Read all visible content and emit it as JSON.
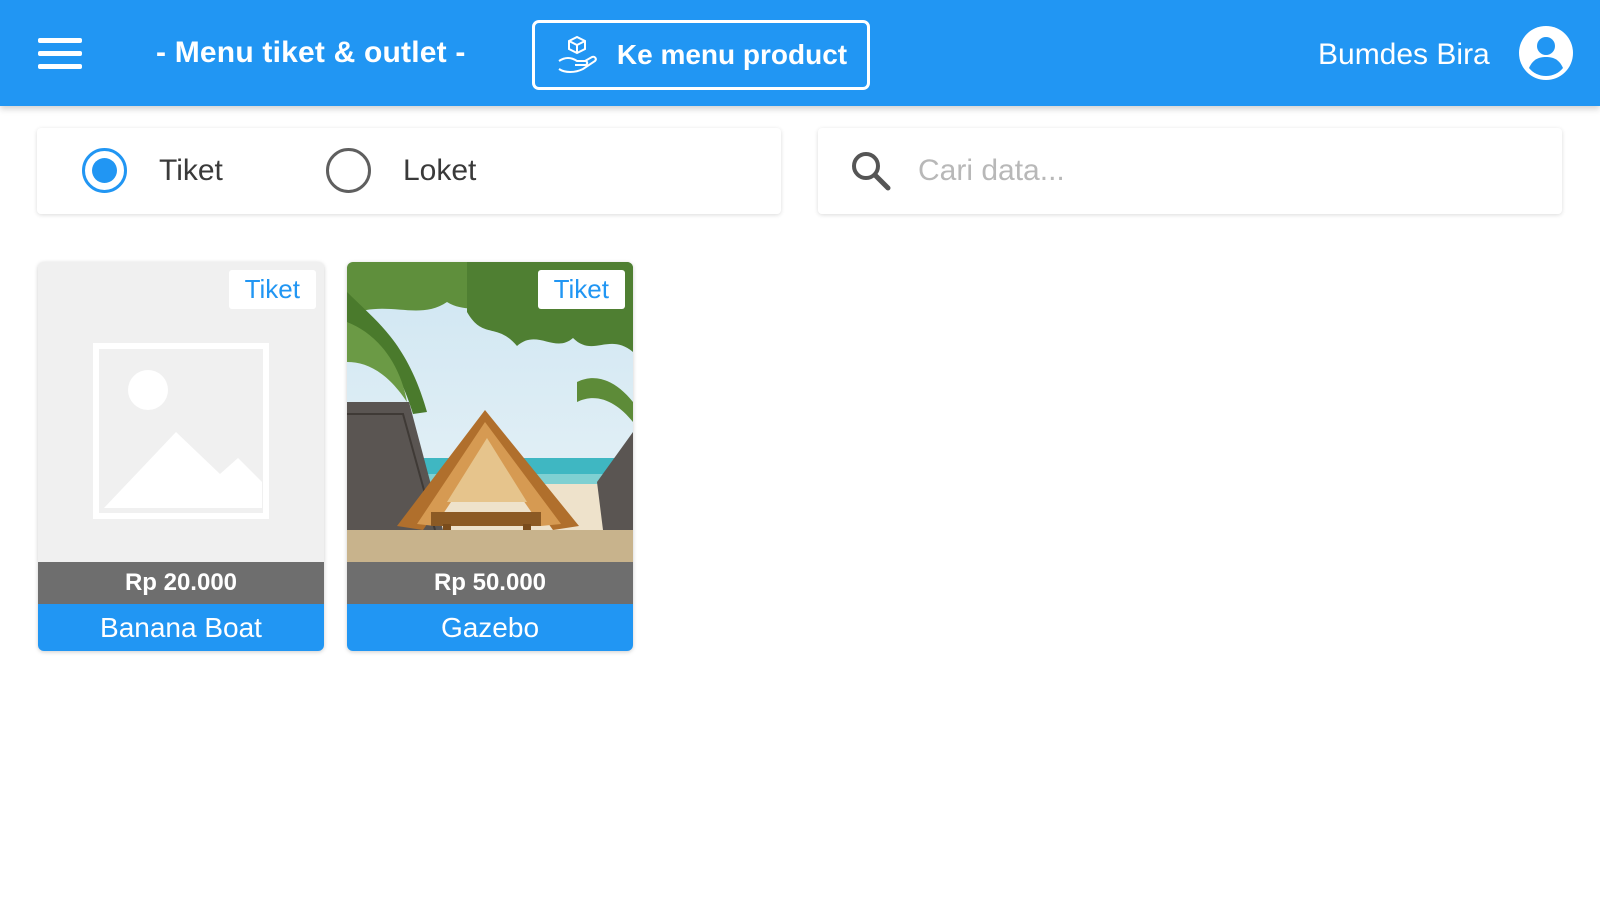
{
  "header": {
    "title": "- Menu tiket & outlet -",
    "product_button_label": "Ke menu product",
    "product_button_icon": "box-hand-icon",
    "user_name": "Bumdes Bira",
    "menu_icon": "hamburger-menu-icon",
    "avatar_icon": "account-circle-icon",
    "accent_color": "#2196f3"
  },
  "filter": {
    "options": [
      {
        "label": "Tiket",
        "selected": true
      },
      {
        "label": "Loket",
        "selected": false
      }
    ]
  },
  "search": {
    "placeholder": "Cari data...",
    "value": "",
    "icon": "search-icon"
  },
  "items": [
    {
      "tag": "Tiket",
      "price": "Rp 20.000",
      "name": "Banana Boat",
      "image": "placeholder-image-icon"
    },
    {
      "tag": "Tiket",
      "price": "Rp 50.000",
      "name": "Gazebo",
      "image": "beach-gazebo-photo"
    }
  ]
}
